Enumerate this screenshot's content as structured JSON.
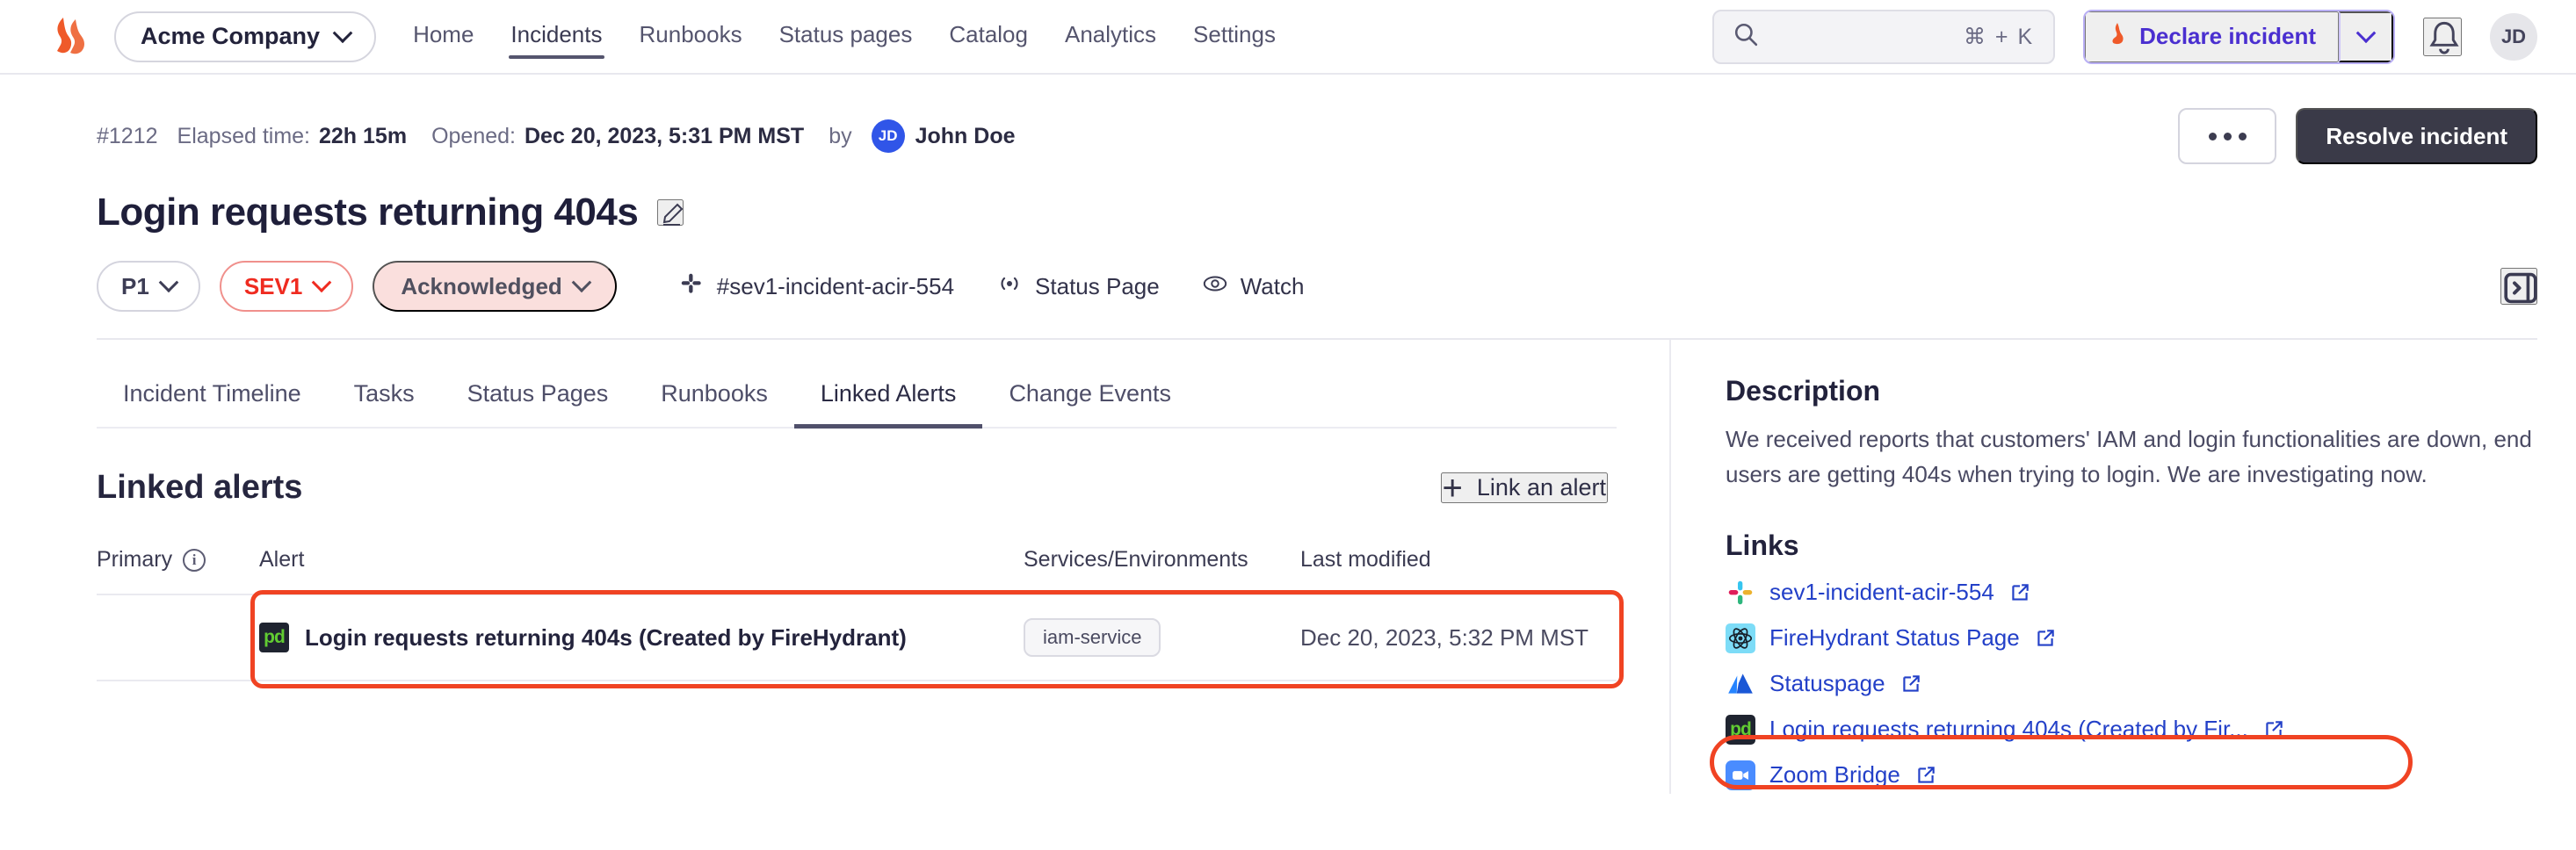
{
  "topnav": {
    "logo": "firehydrant-logo",
    "org": "Acme Company",
    "links": [
      "Home",
      "Incidents",
      "Runbooks",
      "Status pages",
      "Catalog",
      "Analytics",
      "Settings"
    ],
    "active_link": "Incidents",
    "search": {
      "placeholder": "",
      "value": "",
      "shortcut": "⌘ + K"
    },
    "declare": {
      "label": "Declare incident"
    },
    "avatar": "JD"
  },
  "incident": {
    "id": "#1212",
    "elapsed_label": "Elapsed time:",
    "elapsed_value": "22h 15m",
    "opened_label": "Opened:",
    "opened_value": "Dec 20, 2023, 5:31 PM MST",
    "by_label": "by",
    "author_initials": "JD",
    "author": "John Doe",
    "more_button": "…",
    "resolve_button": "Resolve incident",
    "title": "Login requests returning 404s",
    "priority": "P1",
    "severity": "SEV1",
    "status": "Acknowledged",
    "slack_channel": "#sev1-incident-acir-554",
    "status_page": "Status Page",
    "watch": "Watch"
  },
  "tabs": {
    "items": [
      "Incident Timeline",
      "Tasks",
      "Status Pages",
      "Runbooks",
      "Linked Alerts",
      "Change Events"
    ],
    "active": "Linked Alerts"
  },
  "linked_alerts": {
    "heading": "Linked alerts",
    "link_alert_button": "Link an alert",
    "columns": [
      "Primary",
      "Alert",
      "Services/Environments",
      "Last modified"
    ],
    "rows": [
      {
        "primary": "",
        "icon": "pagerduty-icon",
        "alert": "Login requests returning 404s (Created by FireHydrant)",
        "service": "iam-service",
        "last_modified": "Dec 20, 2023, 5:32 PM MST"
      }
    ]
  },
  "sidebar": {
    "description_heading": "Description",
    "description": "We received reports that customers' IAM and login functionalities are down, end users are getting 404s when trying to login. We are investigating now.",
    "links_heading": "Links",
    "links": [
      {
        "label": "sev1-incident-acir-554",
        "icon": "slack-icon"
      },
      {
        "label": "FireHydrant Status Page",
        "icon": "atom-icon"
      },
      {
        "label": "Statuspage",
        "icon": "atlassian-icon"
      },
      {
        "label": "Login requests returning 404s (Created by Fir...",
        "icon": "pagerduty-icon"
      },
      {
        "label": "Zoom Bridge",
        "icon": "zoom-icon"
      }
    ]
  },
  "colors": {
    "brand_orange": "#ef5a2a",
    "annotation_red": "#f04323",
    "severity_red": "#ef2b20",
    "link_blue": "#2340c8",
    "declare_purple": "#4a2fd0",
    "dark_button": "#3a3a48"
  }
}
